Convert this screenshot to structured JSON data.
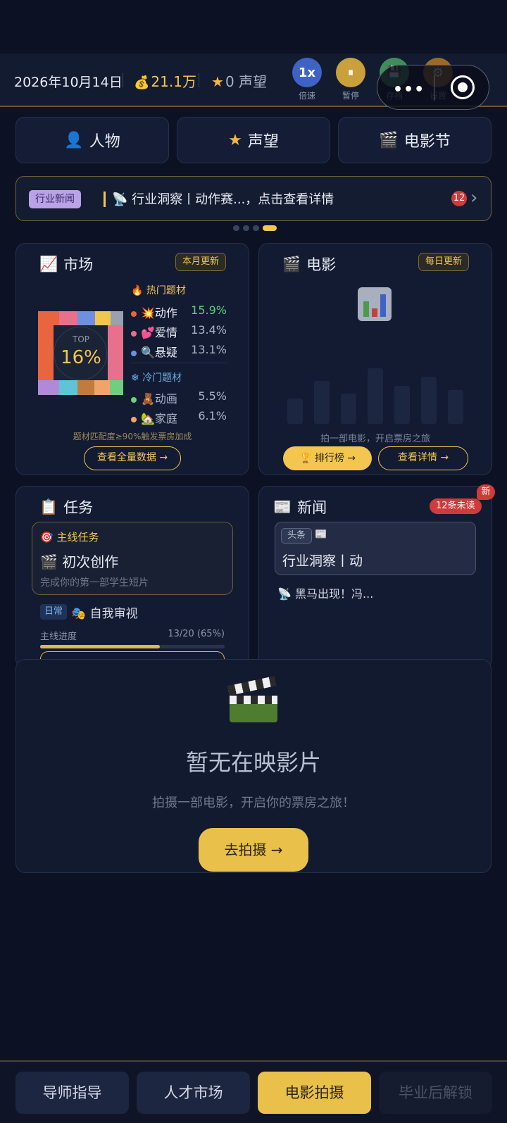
{
  "topbar": {
    "date": "2026年10月14日",
    "money": "21.1万",
    "reputation_value": "0",
    "reputation_label": "声望",
    "buttons": [
      {
        "glyph": "1x",
        "label": "倍速",
        "color": "#3f63c4"
      },
      {
        "glyph": "⏸",
        "label": "暂停",
        "color": "#c9a03c"
      },
      {
        "glyph": "💾",
        "label": "存档",
        "color": "#3f8e5a"
      },
      {
        "glyph": "⚙",
        "label": "设置",
        "color": "#9a6a2a"
      }
    ]
  },
  "quick_tabs": [
    {
      "icon": "👤",
      "label": "人物"
    },
    {
      "icon": "★",
      "label": "声望"
    },
    {
      "icon": "🎬",
      "label": "电影节"
    }
  ],
  "ticker": {
    "badge": "行业新闻",
    "text": "📡 行业洞察丨动作赛...，点击查看详情",
    "count": "12"
  },
  "market": {
    "title": "市场",
    "update_tag": "本月更新",
    "top_label": "TOP",
    "top_value": "16%",
    "hot_title": "热门题材",
    "hot": [
      {
        "name": "💥动作",
        "pct": "15.9%",
        "dot": "#e9653f",
        "pct_color": "#5fd07a"
      },
      {
        "name": "💕爱情",
        "pct": "13.4%",
        "dot": "#e8708c",
        "pct_color": "#aab3c6"
      },
      {
        "name": "🔍悬疑",
        "pct": "13.1%",
        "dot": "#6f8fe0",
        "pct_color": "#aab3c6"
      }
    ],
    "cold_title": "冷门题材",
    "cold": [
      {
        "name": "🧸动画",
        "pct": "5.5%",
        "dot": "#6fcf7f"
      },
      {
        "name": "🏡家庭",
        "pct": "6.1%",
        "dot": "#f0a46a"
      }
    ],
    "hint": "题材匹配度≥90%触发票房加成",
    "button": "查看全量数据 →"
  },
  "movie": {
    "title": "电影",
    "update_tag": "每日更新",
    "hint": "拍一部电影，开启票房之旅",
    "rank_button": "🏆 排行榜 →",
    "detail_button": "查看详情 →"
  },
  "tasks": {
    "title": "任务",
    "main_tag": "主线任务",
    "main_name": "初次创作",
    "main_desc": "完成你的第一部学生短片",
    "daily_tag": "日常",
    "daily_name": "自我审视",
    "progress_label": "主线进度",
    "progress_text": "13/20 (65%)",
    "progress_fraction": 0.65
  },
  "news": {
    "title": "新闻",
    "unread": "12条未读",
    "new_badge": "新",
    "headline_tag": "头条",
    "headline_text": "行业洞察丨动",
    "item": "黑马出现！冯..."
  },
  "empty_state": {
    "title": "暂无在映影片",
    "subtitle": "拍摄一部电影，开启你的票房之旅！",
    "button": "去拍摄 →"
  },
  "bottom_nav": [
    {
      "label": "导师指导"
    },
    {
      "label": "人才市场"
    },
    {
      "label": "电影拍摄"
    },
    {
      "label": "毕业后解锁"
    }
  ]
}
